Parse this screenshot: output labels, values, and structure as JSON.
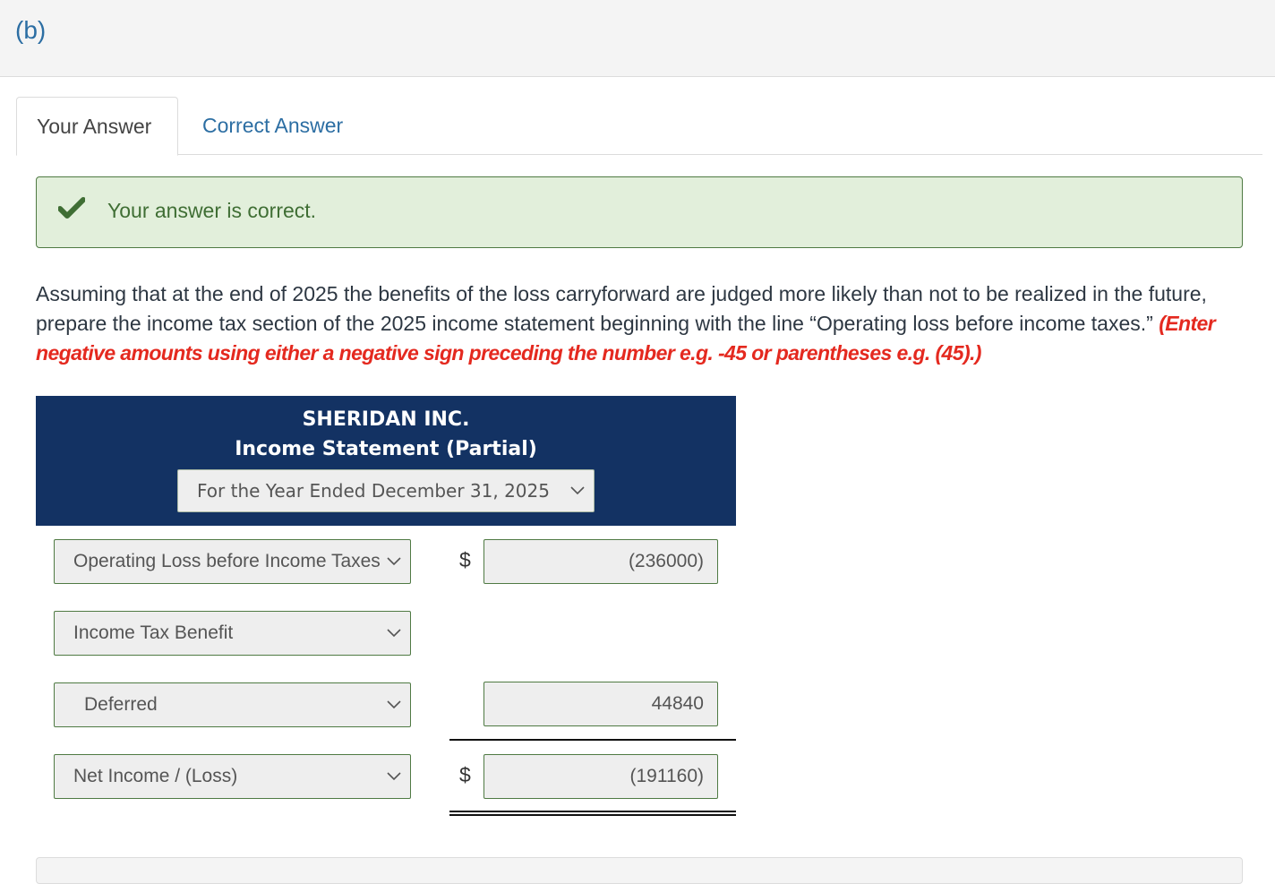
{
  "part": {
    "label": "(b)"
  },
  "tabs": [
    {
      "label": "Your Answer",
      "active": true
    },
    {
      "label": "Correct Answer",
      "active": false
    }
  ],
  "alert": {
    "icon": "check-icon",
    "text": "Your answer is correct.",
    "color": "#3f6e34"
  },
  "question": {
    "text": "Assuming that at the end of 2025 the benefits of the loss carryforward are judged more likely than not to be realized in the future, prepare the income tax section of the 2025 income statement beginning with the line “Operating loss before income taxes.” ",
    "instruction": "(Enter negative amounts using either a negative sign preceding the number e.g. -45 or parentheses e.g. (45).)"
  },
  "statement": {
    "company": "SHERIDAN INC.",
    "title": "Income Statement (Partial)",
    "period_select": "For the Year Ended December 31, 2025",
    "rows": [
      {
        "label": "Operating Loss before Income Taxes",
        "currency": "$",
        "value": "(236000)"
      },
      {
        "label": "Income Tax Benefit",
        "currency": "",
        "value": ""
      },
      {
        "label": "Deferred",
        "currency": "",
        "value": "44840"
      },
      {
        "label": "Net Income / (Loss)",
        "currency": "$",
        "value": "(191160)"
      }
    ]
  },
  "colors": {
    "header_bg": "#133263",
    "link": "#2c6ea3",
    "success_bg": "#e2efdb",
    "instruction_red": "#e4291f"
  }
}
